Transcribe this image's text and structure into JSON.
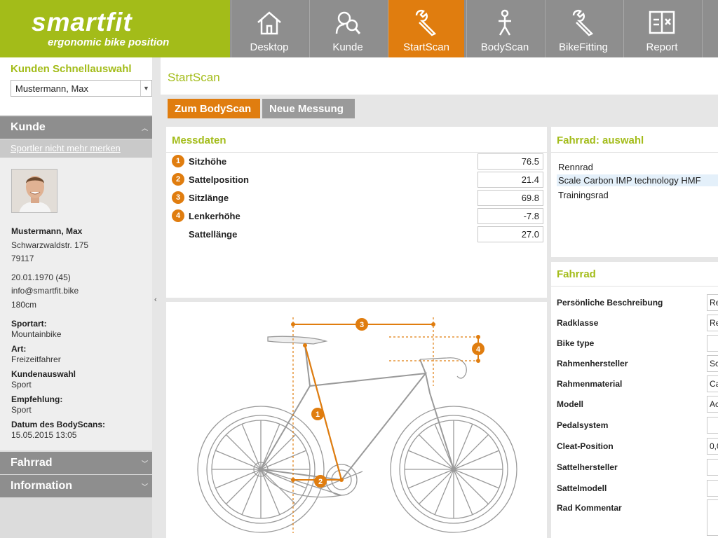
{
  "app": {
    "logo_word": "smartfit",
    "logo_sub": "ergonomic bike position",
    "accent": "#a3bc19",
    "orange": "#e07d0f"
  },
  "nav": [
    {
      "label": "Desktop",
      "icon": "home-icon"
    },
    {
      "label": "Kunde",
      "icon": "customer-search-icon"
    },
    {
      "label": "StartScan",
      "icon": "wrench-icon",
      "active": true
    },
    {
      "label": "BodyScan",
      "icon": "person-icon"
    },
    {
      "label": "BikeFitting",
      "icon": "wrench-icon"
    },
    {
      "label": "Report",
      "icon": "report-icon"
    }
  ],
  "sidebar": {
    "quick_title": "Kunden Schnellauswahl",
    "quick_value": "Mustermann, Max",
    "kunde_header": "Kunde",
    "forget_link": "Sportler nicht mehr merken",
    "name": "Mustermann, Max",
    "street": "Schwarzwaldstr. 175",
    "zip": "79117",
    "birth": "20.01.1970 (45)",
    "email": "info@smartfit.bike",
    "height": "180cm",
    "sportart_label": "Sportart:",
    "sportart_value": "Mountainbike",
    "art_label": "Art:",
    "art_value": "Freizeitfahrer",
    "kundenauswahl_label": "Kundenauswahl",
    "kundenauswahl_value": "Sport",
    "empfehlung_label": "Empfehlung:",
    "empfehlung_value": "Sport",
    "datum_label": "Datum des BodyScans:",
    "datum_value": "15.05.2015 13:05",
    "fahrrad_header": "Fahrrad",
    "information_header": "Information"
  },
  "main": {
    "title": "StartScan",
    "btn_bodyscan": "Zum BodyScan",
    "btn_new": "Neue Messung"
  },
  "messdaten": {
    "title": "Messdaten",
    "rows": [
      {
        "num": "1",
        "label": "Sitzhöhe",
        "value": "76.5"
      },
      {
        "num": "2",
        "label": "Sattelposition",
        "value": "21.4"
      },
      {
        "num": "3",
        "label": "Sitzlänge",
        "value": "69.8"
      },
      {
        "num": "4",
        "label": "Lenkerhöhe",
        "value": "-7.8"
      },
      {
        "num": "",
        "label": "Sattellänge",
        "value": "27.0"
      }
    ]
  },
  "fahrrad_auswahl": {
    "title": "Fahrrad: auswahl",
    "items": [
      "Rennrad",
      "Scale Carbon IMP technology HMF",
      "Trainingsrad"
    ],
    "selected_index": 1
  },
  "fahrrad": {
    "title": "Fahrrad",
    "rows": [
      {
        "label": "Persönliche Beschreibung",
        "value": "Re"
      },
      {
        "label": "Radklasse",
        "value": "Re"
      },
      {
        "label": "Bike type",
        "value": ""
      },
      {
        "label": "Rahmenhersteller",
        "value": "Sc"
      },
      {
        "label": "Rahmenmaterial",
        "value": "Ca"
      },
      {
        "label": "Modell",
        "value": "Ac"
      },
      {
        "label": "Pedalsystem",
        "value": ""
      },
      {
        "label": "Cleat-Position",
        "value": "0,0"
      },
      {
        "label": "Sattelhersteller",
        "value": ""
      },
      {
        "label": "Sattelmodell",
        "value": ""
      },
      {
        "label": "Rad Kommentar",
        "value": ""
      }
    ]
  },
  "diagram_badges": [
    "1",
    "2",
    "3",
    "4"
  ]
}
